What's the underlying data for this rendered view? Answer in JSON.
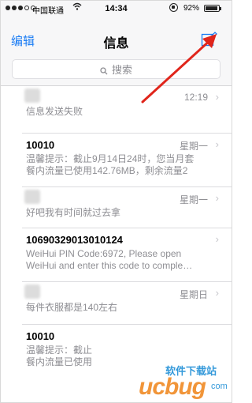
{
  "status_bar": {
    "carrier": "中国联通",
    "time": "14:34",
    "battery": "92%"
  },
  "nav": {
    "edit_label": "编辑",
    "title": "信息"
  },
  "search": {
    "placeholder": "搜索"
  },
  "conversations": [
    {
      "name": "",
      "time": "12:19",
      "preview_line1": "信息发送失败",
      "preview_line2": ""
    },
    {
      "name": "10010",
      "time": "星期一",
      "preview_line1": "温馨提示：截止9月14日24时，您当月套",
      "preview_line2": "餐内流量已使用142.76MB，剩余流量2"
    },
    {
      "name": "",
      "time": "星期一",
      "preview_line1": "好吧我有时间就过去拿",
      "preview_line2": ""
    },
    {
      "name": "10690329013010124",
      "time": "",
      "preview_line1": "WeiHui PIN Code:6972, Please open",
      "preview_line2": "WeiHui and enter this code to comple…"
    },
    {
      "name": "",
      "time": "星期日",
      "preview_line1": "每件衣服都是140左右",
      "preview_line2": ""
    },
    {
      "name": "10010",
      "time": "",
      "preview_line1": "温馨提示：截止",
      "preview_line2": "餐内流量已使用"
    }
  ],
  "watermark": {
    "text": "软件下载站",
    "brand": "ucbug",
    "suffix": "com"
  },
  "colors": {
    "accent": "#1a7cf4",
    "secondary_text": "#8e8e93",
    "annotation_arrow": "#e0251b",
    "watermark_orange": "#f08a24",
    "watermark_blue": "#1f8fd6"
  }
}
